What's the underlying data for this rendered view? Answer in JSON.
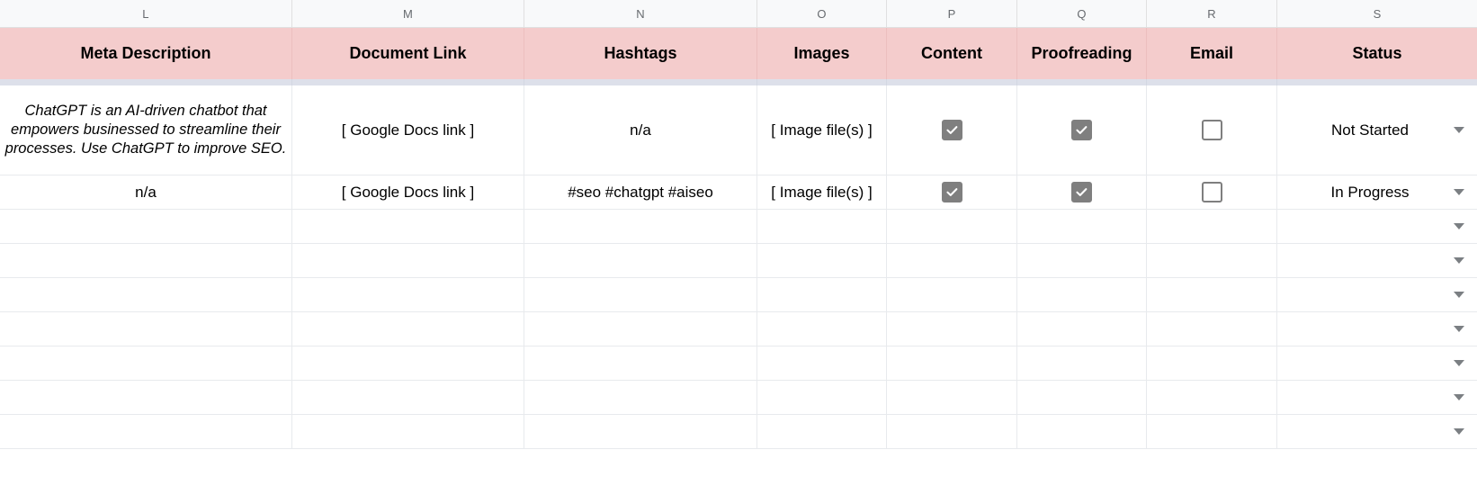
{
  "spreadsheet": {
    "column_letters": [
      "L",
      "M",
      "N",
      "O",
      "P",
      "Q",
      "R",
      "S"
    ],
    "headers": [
      "Meta Description",
      "Document Link",
      "Hashtags",
      "Images",
      "Content",
      "Proofreading",
      "Email",
      "Status"
    ],
    "rows": [
      {
        "meta_description": "ChatGPT is an AI-driven chatbot that empowers businessed to streamline their processes. Use ChatGPT to improve SEO.",
        "document_link": "[ Google Docs link ]",
        "hashtags": "n/a",
        "images": "[ Image file(s) ]",
        "content_checked": true,
        "proofreading_checked": true,
        "email_checked": false,
        "status": "Not Started"
      },
      {
        "meta_description": "n/a",
        "document_link": "[ Google Docs link ]",
        "hashtags": "#seo #chatgpt #aiseo",
        "images": "[ Image file(s) ]",
        "content_checked": true,
        "proofreading_checked": true,
        "email_checked": false,
        "status": "In Progress"
      }
    ],
    "empty_row_count": 7,
    "colors": {
      "header_fill": "#f4cccc",
      "column_strip": "#f8f9fa",
      "separator_band": "#dde0ea",
      "gridline": "#e8eaed",
      "checkbox_fill": "#7f7f7f",
      "caret": "#7b7f83"
    },
    "icons": {
      "checkbox_checked": "checkbox-checked-icon",
      "checkbox_unchecked": "checkbox-unchecked-icon",
      "dropdown": "chevron-down-icon"
    }
  }
}
